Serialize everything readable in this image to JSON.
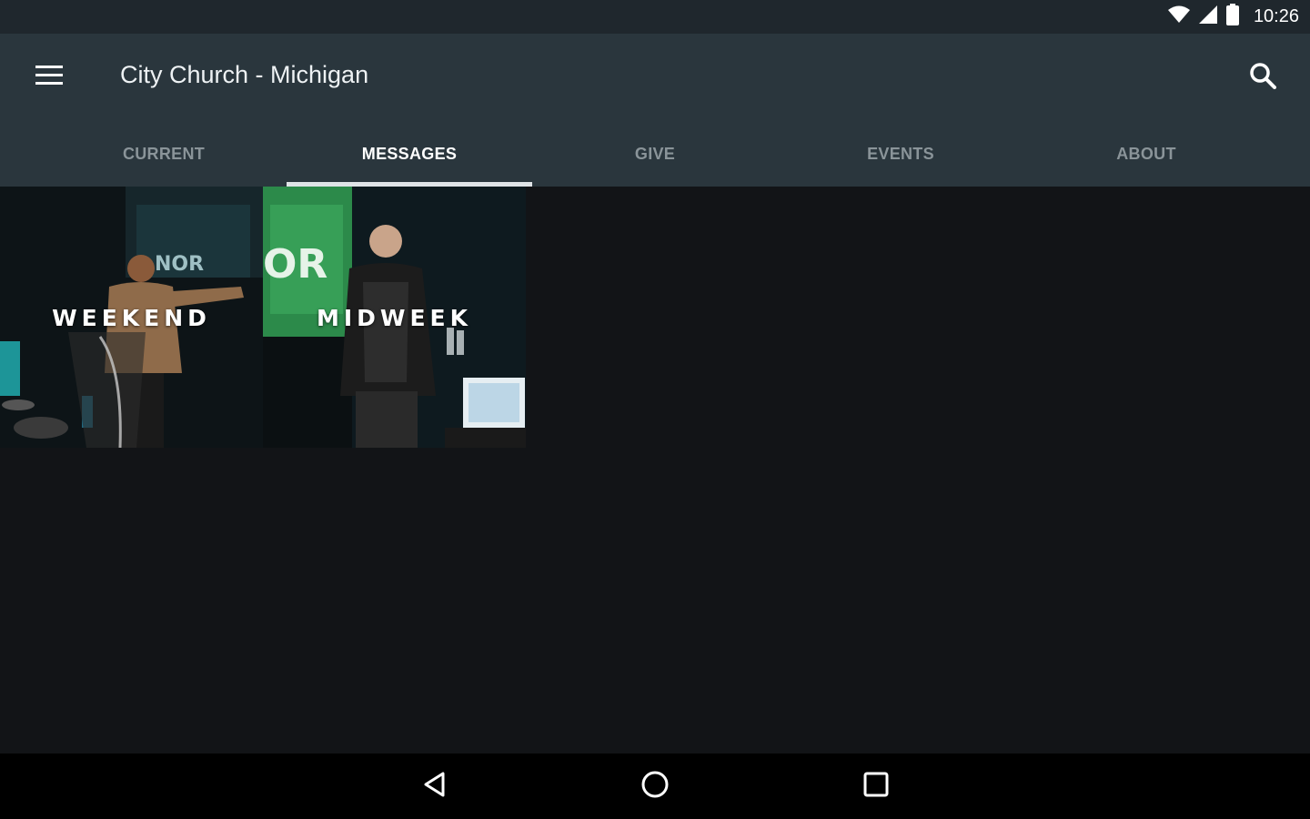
{
  "status_bar": {
    "time": "10:26",
    "icons": [
      "wifi-icon",
      "cell-signal-icon",
      "battery-icon"
    ]
  },
  "app_bar": {
    "title": "City Church - Michigan",
    "menu_icon": "hamburger-menu-icon",
    "search_icon": "search-icon"
  },
  "tabs": [
    {
      "label": "CURRENT",
      "active": false
    },
    {
      "label": "MESSAGES",
      "active": true
    },
    {
      "label": "GIVE",
      "active": false
    },
    {
      "label": "EVENTS",
      "active": false
    },
    {
      "label": "ABOUT",
      "active": false
    }
  ],
  "tiles": [
    {
      "label": "WEEKEND",
      "image": "preacher-at-podium-photo"
    },
    {
      "label": "MIDWEEK",
      "image": "speaker-on-stage-photo"
    }
  ],
  "nav_bar": {
    "icons": [
      "back-icon",
      "home-icon",
      "recents-icon"
    ]
  },
  "colors": {
    "status_bar": "#1f272d",
    "app_bar": "#2a363d",
    "background": "#121417",
    "tab_indicator": "#dfe4e7",
    "inactive_tab": "#8a9499"
  }
}
